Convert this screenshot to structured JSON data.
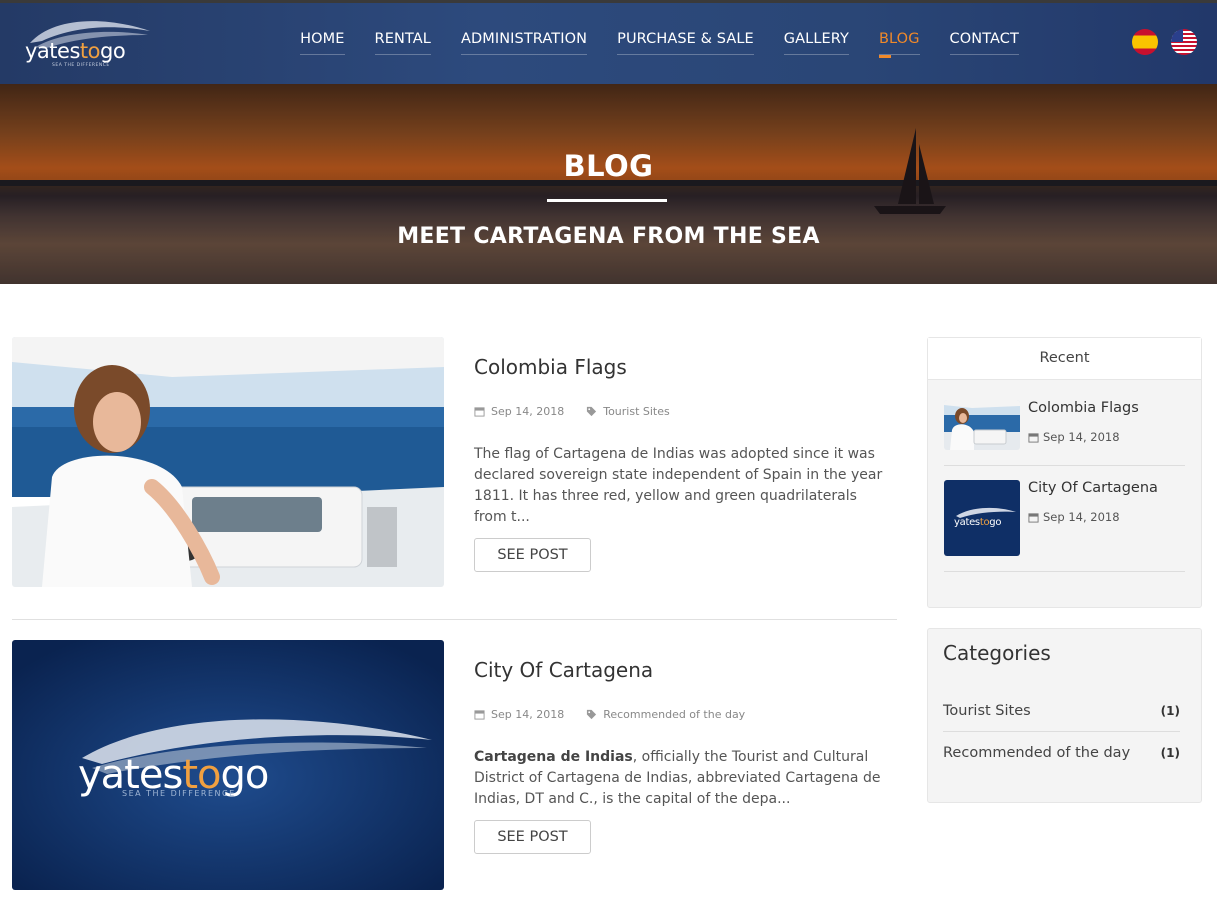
{
  "header": {
    "logo_text": "yatestogo",
    "logo_tagline": "SEA THE DIFFERENCE",
    "nav": [
      "HOME",
      "RENTAL",
      "ADMINISTRATION",
      "PURCHASE & SALE",
      "GALLERY",
      "BLOG",
      "CONTACT"
    ],
    "active_nav": "BLOG",
    "languages": [
      "spanish-flag-icon",
      "us-flag-icon"
    ],
    "accent_color": "#f0892a"
  },
  "hero": {
    "title": "BLOG",
    "subtitle": "MEET CARTAGENA FROM THE SEA"
  },
  "posts": [
    {
      "title": "Colombia Flags",
      "date": "Sep 14, 2018",
      "category": "Tourist Sites",
      "excerpt": "The flag of Cartagena de Indias was adopted since it was declared sovereign state independent of Spain in the year 1811. It has three red, yellow and green quadrilaterals from t...",
      "button": "SEE POST"
    },
    {
      "title": "City Of Cartagena",
      "date": "Sep 14, 2018",
      "category": "Recommended of the day",
      "excerpt_bold": "Cartagena de Indias",
      "excerpt": ", officially the Tourist and Cultural District of Cartagena de Indias, abbreviated Cartagena de Indias, DT and C., is the capital of the depa...",
      "button": "SEE POST"
    }
  ],
  "sidebar": {
    "recent_title": "Recent",
    "recent": [
      {
        "title": "Colombia Flags",
        "date": "Sep 14, 2018"
      },
      {
        "title": "City Of Cartagena",
        "date": "Sep 14, 2018"
      }
    ],
    "categories_title": "Categories",
    "categories": [
      {
        "label": "Tourist Sites",
        "count": "(1)"
      },
      {
        "label": "Recommended of the day",
        "count": "(1)"
      }
    ]
  }
}
